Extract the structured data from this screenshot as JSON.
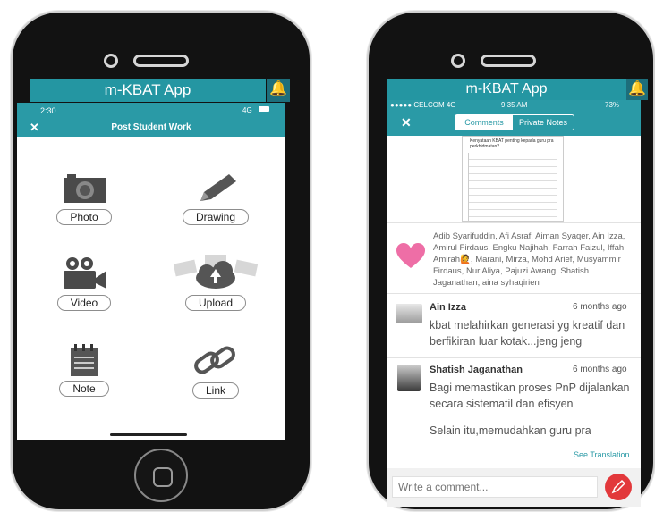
{
  "left_phone": {
    "app_title": "m-KBAT App",
    "status_time": "2:30",
    "status_right": "4G",
    "post_title": "Post Student Work",
    "close_label": "✕",
    "tiles": [
      {
        "label": "Photo",
        "icon": "camera-icon"
      },
      {
        "label": "Drawing",
        "icon": "pencil-icon"
      },
      {
        "label": "Video",
        "icon": "video-camera-icon"
      },
      {
        "label": "Upload",
        "icon": "cloud-upload-icon"
      },
      {
        "label": "Note",
        "icon": "notepad-icon"
      },
      {
        "label": "Link",
        "icon": "chain-link-icon"
      }
    ]
  },
  "right_phone": {
    "app_title": "m-KBAT App",
    "carrier": "●●●●● CELCOM  4G",
    "status_time": "9:35 AM",
    "battery": "73%",
    "close_label": "✕",
    "tabs": [
      {
        "label": "Comments"
      },
      {
        "label": "Private Notes"
      }
    ],
    "doc_text": "Kenyataan KBAT penting kepada guru pra perkhidmatan?",
    "likers": "Adib Syarifuddin, Afi Asraf, Aiman Syaqer, Ain Izza, Amirul Firdaus, Engku Najihah, Farrah Faizul, Iffah Amirah🙋, Marani, Mirza, Mohd Arief, Musyammir Firdaus, Nur Aliya, Pajuzi Awang, Shatish Jaganathan, aina syhaqirien",
    "comments": [
      {
        "name": "Ain Izza",
        "time": "6 months ago",
        "text": "kbat melahirkan generasi yg kreatif dan berfikiran luar kotak...jeng jeng"
      },
      {
        "name": "Shatish Jaganathan",
        "time": "6 months ago",
        "text": "Bagi memastikan proses PnP dijalankan secara sistematil dan efisyen",
        "text2": "Selain itu,memudahkan guru pra"
      }
    ],
    "see_translation": "See Translation",
    "comment_placeholder": "Write a comment..."
  }
}
